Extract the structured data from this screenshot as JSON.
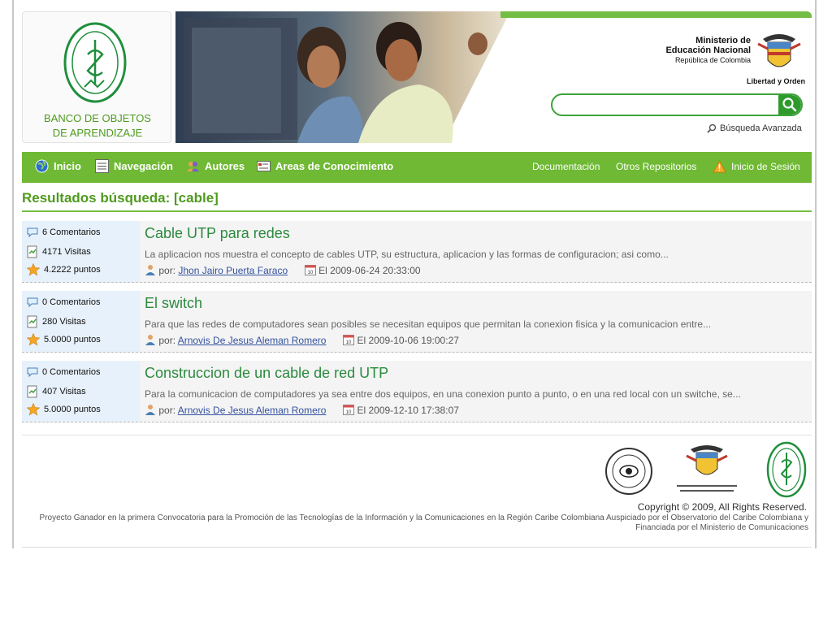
{
  "header": {
    "logo_line1": "BANCO DE OBJETOS",
    "logo_line2": "DE APRENDIZAJE",
    "ministry_line1": "Ministerio de",
    "ministry_line2": "Educación Nacional",
    "ministry_line3": "República de Colombia",
    "ministry_motto": "Libertad y Orden",
    "search": {
      "value": "",
      "placeholder": ""
    },
    "advanced_search": "Búsqueda Avanzada"
  },
  "nav": {
    "left": [
      {
        "label": "Inicio",
        "icon": "globe-icon"
      },
      {
        "label": "Navegación",
        "icon": "list-icon"
      },
      {
        "label": "Autores",
        "icon": "users-icon"
      },
      {
        "label": "Areas de Conocimiento",
        "icon": "card-icon"
      }
    ],
    "right": [
      {
        "label": "Documentación"
      },
      {
        "label": "Otros Repositorios"
      },
      {
        "label": "Inicio de Sesión",
        "icon": "warning-icon"
      }
    ]
  },
  "results": {
    "heading": "Resultados búsqueda: [cable]",
    "items": [
      {
        "comments": "6 Comentarios",
        "visits": "4171 Visitas",
        "points": "4.2222 puntos",
        "title": "Cable UTP para redes",
        "description": "La aplicacion nos muestra el concepto de cables UTP, su estructura, aplicacion y las formas de configuracion; asi como...",
        "by_label": "por:",
        "author": "Jhon Jairo Puerta Faraco",
        "date": "El 2009-06-24 20:33:00"
      },
      {
        "comments": "0 Comentarios",
        "visits": "280 Visitas",
        "points": "5.0000 puntos",
        "title": "El switch",
        "description": "Para que las redes de computadores sean posibles se necesitan equipos que permitan la conexion fisica y la comunicacion entre...",
        "by_label": "por:",
        "author": "Arnovis De Jesus Aleman Romero",
        "date": "El 2009-10-06 19:00:27"
      },
      {
        "comments": "0 Comentarios",
        "visits": "407 Visitas",
        "points": "5.0000 puntos",
        "title": "Construccion de un cable de red UTP",
        "description": "Para la comunicacion de computadores ya sea entre dos equipos, en una conexion punto a punto, o en una red local con un switche, se...",
        "by_label": "por:",
        "author": "Arnovis De Jesus Aleman Romero",
        "date": "El 2009-12-10 17:38:07"
      }
    ]
  },
  "footer": {
    "copyright": "Copyright © 2009, All Rights Reserved.",
    "project_line1": "Proyecto Ganador en la primera Convocatoria para la Promoción de las Tecnologías de la Información y la Comunicaciones en la Región Caribe Colombiana Auspiciado por el Observatorio del Caribe Colombiana y",
    "project_line2": "Financiada por el Ministerio de Comunicaciones"
  },
  "colors": {
    "accent_green": "#6fb934",
    "title_green": "#4f9a1f",
    "link_blue": "#33519e"
  }
}
